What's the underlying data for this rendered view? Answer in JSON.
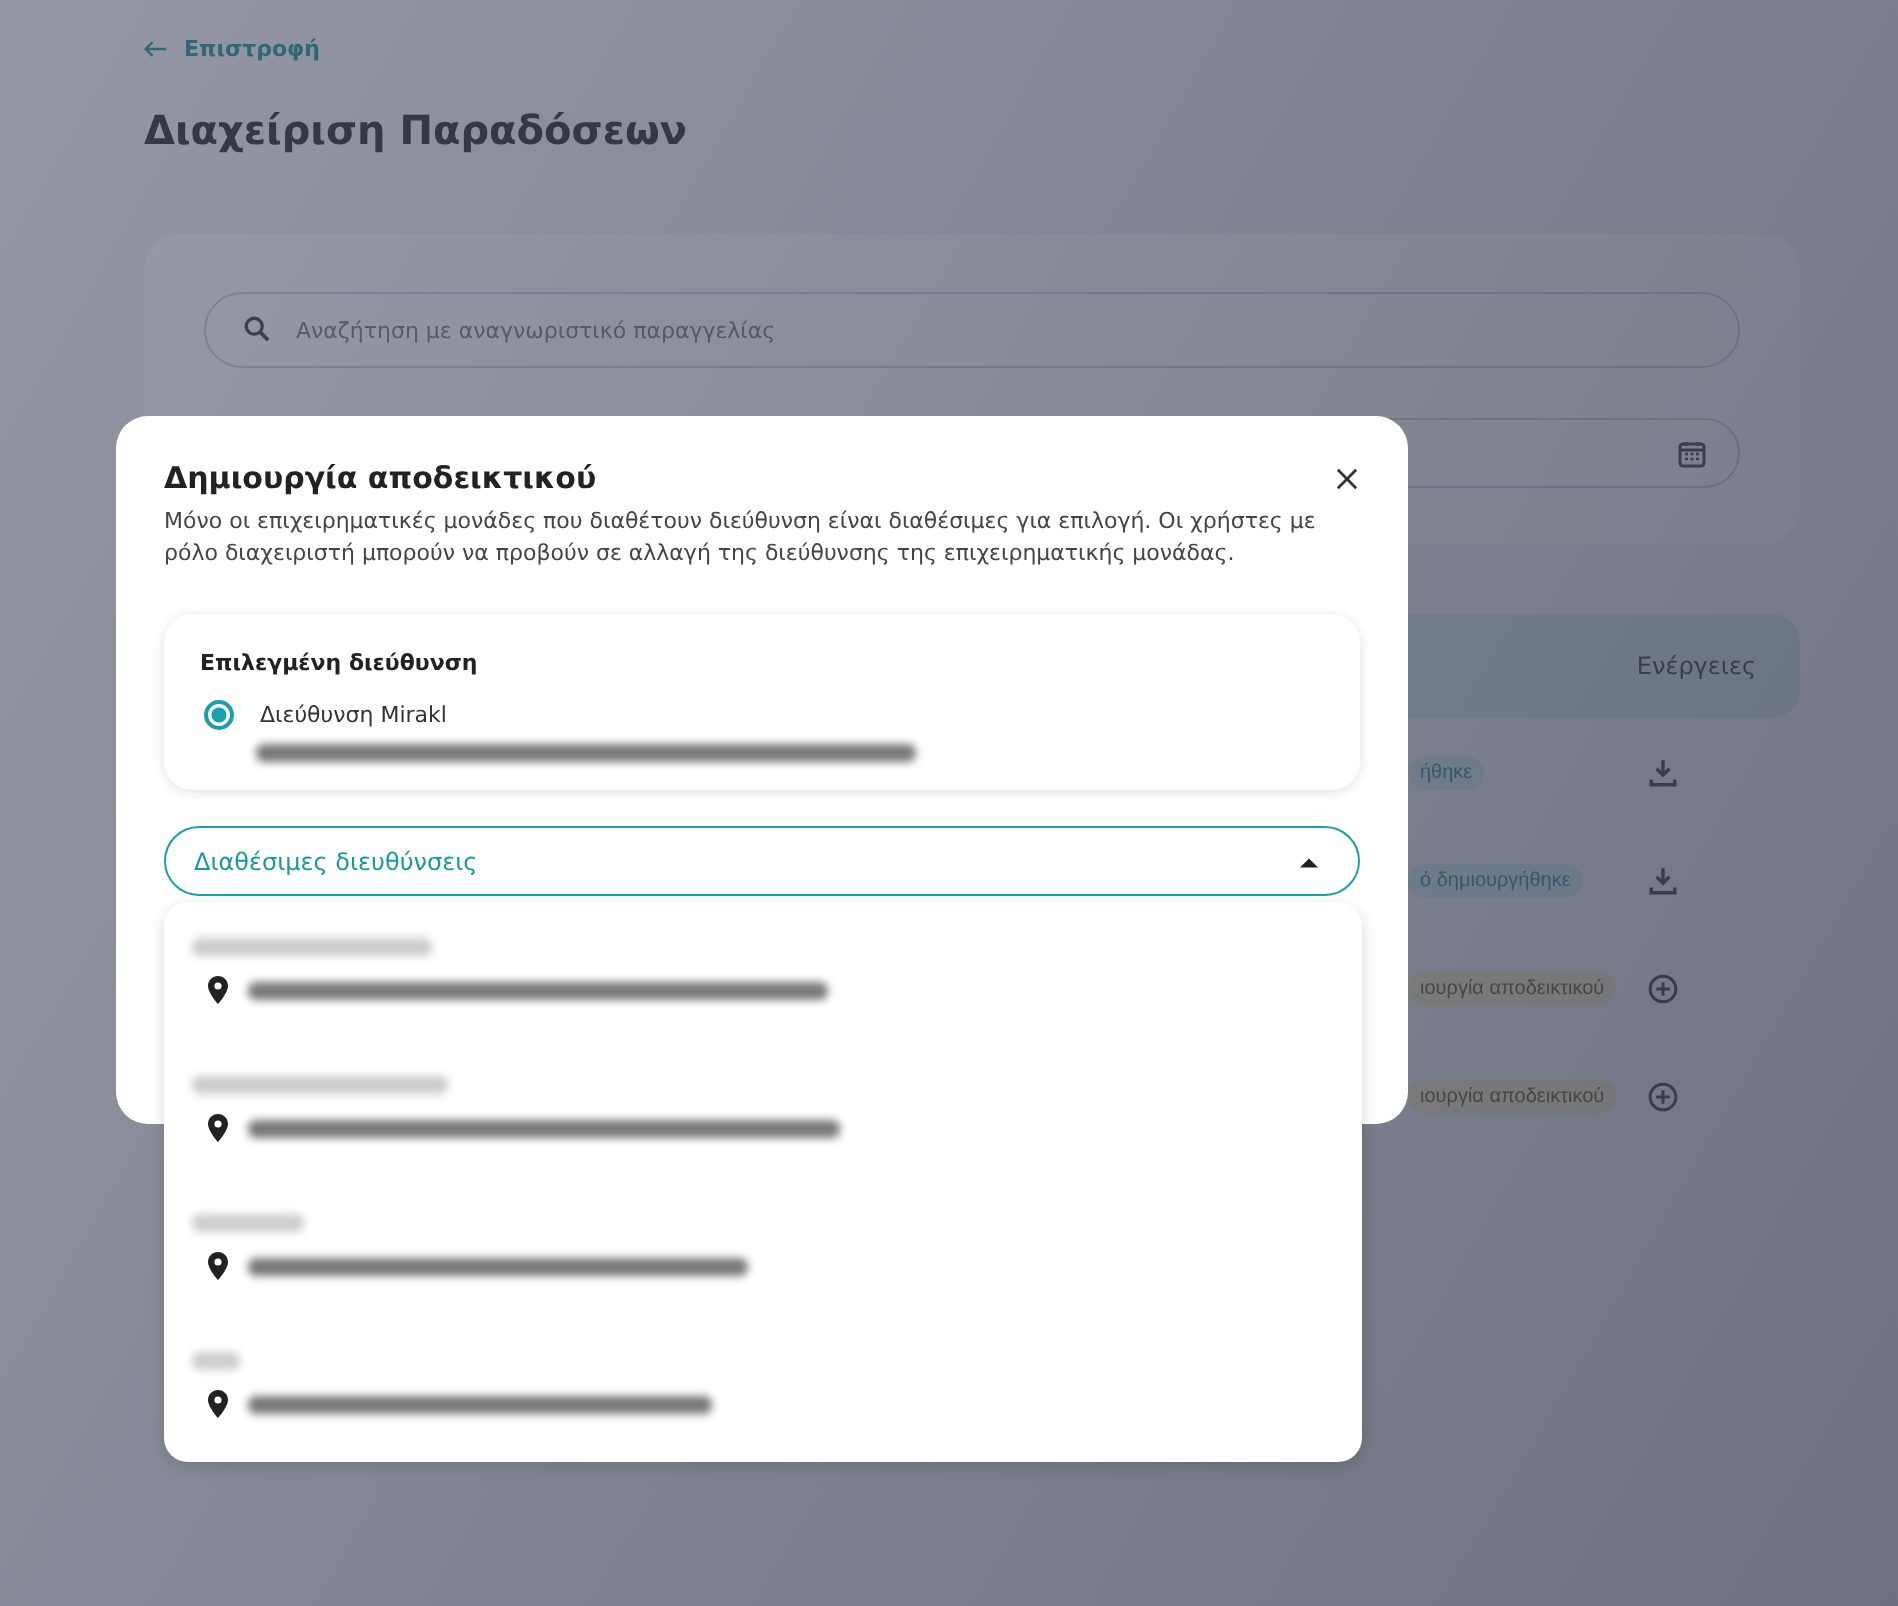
{
  "page": {
    "back_link": "Επιστροφή",
    "title": "Διαχείριση Παραδόσεων",
    "search": {
      "placeholder": "Αναζήτηση με αναγνωριστικό παραγγελίας"
    },
    "table": {
      "action_column": "Ενέργειες",
      "rows": [
        {
          "status": "ήθηκε",
          "kind": "done"
        },
        {
          "status": "ό δημιουργήθηκε",
          "kind": "done"
        },
        {
          "status": "ιουργία αποδεικτικού",
          "kind": "pending"
        },
        {
          "status": "ιουργία αποδεικτικού",
          "kind": "pending"
        }
      ]
    }
  },
  "dialog": {
    "title": "Δημιουργία αποδεικτικού",
    "description": "Μόνο οι επιχειρηματικές μονάδες που διαθέτουν διεύθυνση είναι διαθέσιμες για επιλογή. Οι χρήστες με ρόλο διαχειριστή μπορούν να προβούν σε αλλαγή της διεύθυνσης της επιχειρηματικής μονάδας.",
    "selected_card": {
      "heading": "Επιλεγμένη διεύθυνση",
      "option": {
        "label": "Διεύθυνση Mirakl",
        "selected": true
      }
    },
    "dropdown": {
      "label": "Διαθέσιμες διευθύνσεις",
      "expanded": true,
      "options": [
        {
          "kind": "address"
        },
        {
          "kind": "address"
        },
        {
          "kind": "address"
        },
        {
          "kind": "address"
        }
      ]
    }
  }
}
